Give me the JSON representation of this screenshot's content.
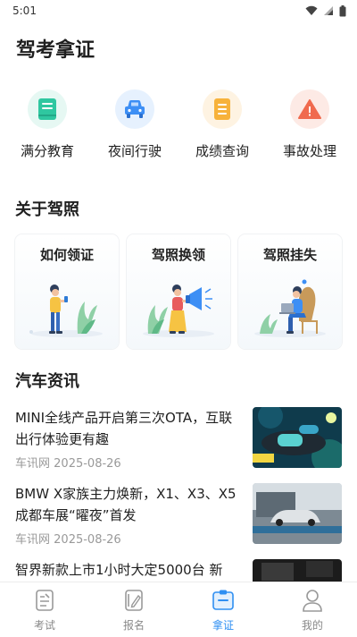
{
  "status_bar": {
    "time": "5:01"
  },
  "app_title": "驾考拿证",
  "quick_actions": [
    {
      "label": "满分教育",
      "icon": "book-icon",
      "color": "#2fc7a0"
    },
    {
      "label": "夜间行驶",
      "icon": "car-icon",
      "color": "#3d8ff5"
    },
    {
      "label": "成绩查询",
      "icon": "document-icon",
      "color": "#f7b23b"
    },
    {
      "label": "事故处理",
      "icon": "warning-icon",
      "color": "#f06a4e"
    }
  ],
  "license_section": {
    "title": "关于驾照",
    "cards": [
      {
        "title": "如何领证"
      },
      {
        "title": "驾照换领"
      },
      {
        "title": "驾照挂失"
      }
    ]
  },
  "news_section": {
    "title": "汽车资讯",
    "items": [
      {
        "title": "MINI全线产品开启第三次OTA，互联出行体验更有趣",
        "source": "车讯网",
        "date": "2025-08-26"
      },
      {
        "title": "BMW X家族主力焕新，X1、X3、X5成都车展“曜夜”首发",
        "source": "车讯网",
        "date": "2025-08-26"
      },
      {
        "title": "智界新款上市1小时大定5000台 新"
      }
    ]
  },
  "bottom_nav": [
    {
      "label": "考试",
      "icon": "exam-icon",
      "active": false
    },
    {
      "label": "报名",
      "icon": "signup-icon",
      "active": false
    },
    {
      "label": "拿证",
      "icon": "license-icon",
      "active": true
    },
    {
      "label": "我的",
      "icon": "profile-icon",
      "active": false
    }
  ],
  "colors": {
    "accent": "#2f8ff2",
    "inactive": "#888888"
  }
}
